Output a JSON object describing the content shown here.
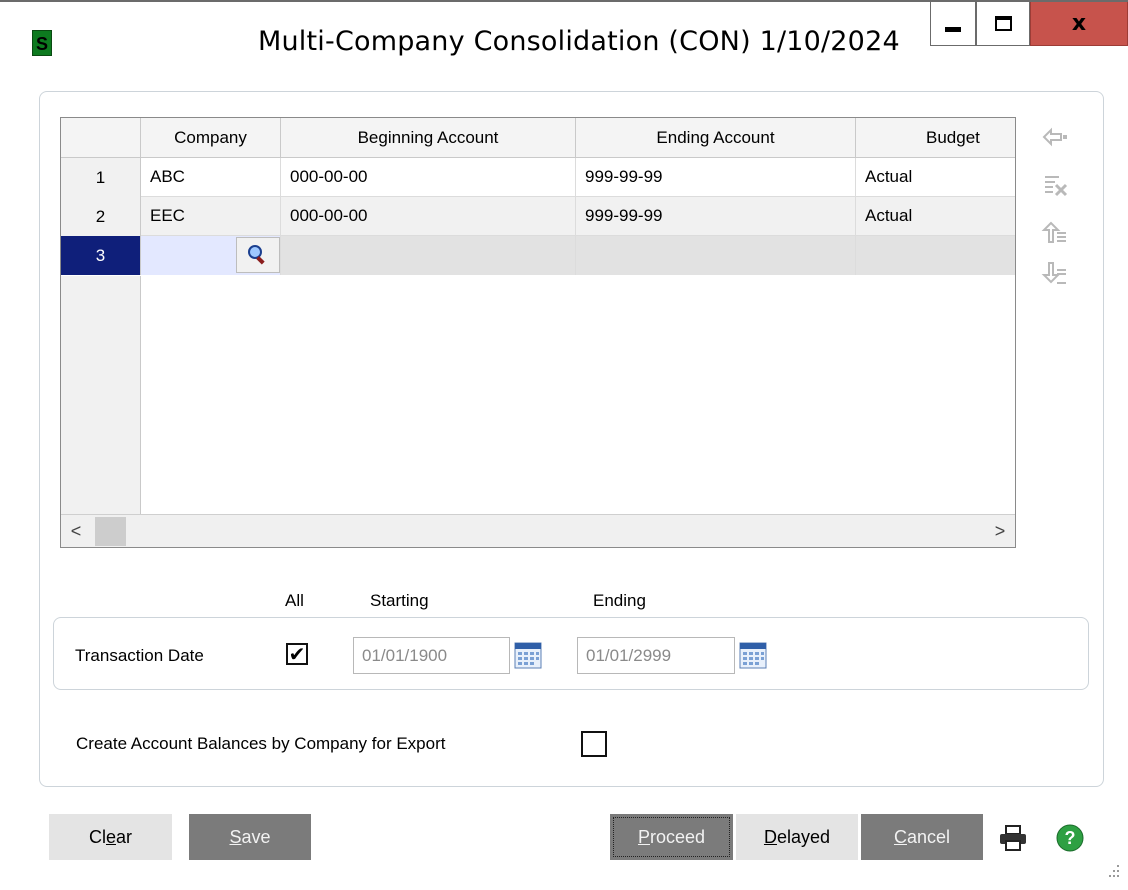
{
  "window": {
    "app_icon_letter": "S",
    "title": "Multi-Company Consolidation (CON) 1/10/2024",
    "close_label": "x"
  },
  "grid": {
    "columns": [
      "",
      "Company",
      "Beginning Account",
      "Ending Account",
      "Budget"
    ],
    "rows": [
      {
        "num": "1",
        "company": "ABC",
        "begin": "000-00-00",
        "end": "999-99-99",
        "budget": "Actual"
      },
      {
        "num": "2",
        "company": "EEC",
        "begin": "000-00-00",
        "end": "999-99-99",
        "budget": "Actual"
      },
      {
        "num": "3",
        "company": "",
        "begin": "",
        "end": "",
        "budget": ""
      }
    ],
    "scroll_left": "<",
    "scroll_right": ">"
  },
  "date_filter": {
    "col_all": "All",
    "col_starting": "Starting",
    "col_ending": "Ending",
    "label": "Transaction Date",
    "all_checked": true,
    "check_mark": "✔",
    "starting_value": "01/01/1900",
    "ending_value": "01/01/2999"
  },
  "export": {
    "label": "Create Account Balances by Company for Export",
    "checked": false
  },
  "buttons": {
    "clear_pre": "Cl",
    "clear_u": "e",
    "clear_post": "ar",
    "save_u": "S",
    "save_post": "ave",
    "proceed_u": "P",
    "proceed_post": "roceed",
    "delayed_u": "D",
    "delayed_post": "elayed",
    "cancel_u": "C",
    "cancel_post": "ancel"
  },
  "colors": {
    "title_close": "#c7534c",
    "row_selected": "#0f1f7a",
    "button_dark": "#7b7b7b",
    "help_green": "#2ea043"
  }
}
